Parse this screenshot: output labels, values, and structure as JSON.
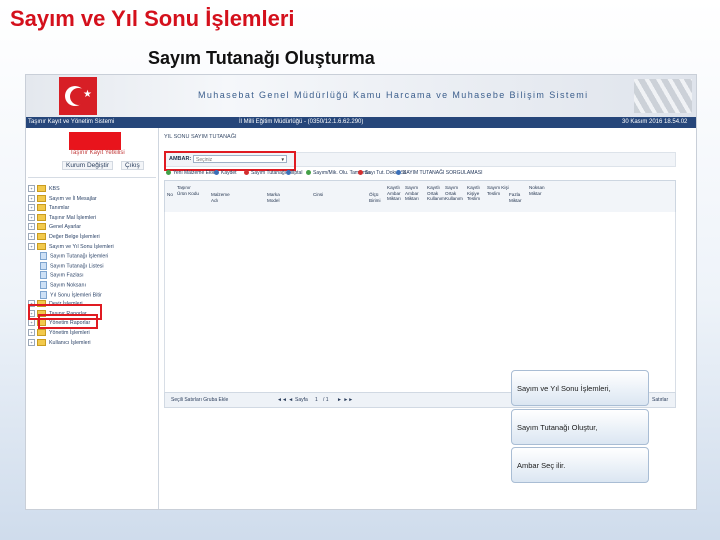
{
  "slide": {
    "title": "Sayım ve Yıl Sonu İşlemleri",
    "subtitle": "Sayım Tutanağı Oluşturma"
  },
  "app": {
    "banner_text": "Muhasebat Genel Müdürlüğü Kamu Harcama ve Muhasebe Bilişim Sistemi",
    "status_left": "Taşınır Kayıt ve Yönetim Sistemi",
    "status_center": "İl Milli Eğitim Müdürlüğü - (0350/12.1.6.62.290)",
    "status_right": "30 Kasım 2016 18.54.02"
  },
  "left_panel": {
    "link_text": "Taşınır Kayıt Yetkilisi",
    "buttons": [
      "Kurum Değiştir",
      "Çıkış"
    ],
    "tree": [
      {
        "label": "KBS",
        "kind": "folder",
        "level": 0
      },
      {
        "label": "Sayım ve İl Mesajlar",
        "kind": "folder",
        "level": 0
      },
      {
        "label": "Tanımlar",
        "kind": "folder",
        "level": 0
      },
      {
        "label": "Taşınır Mal İşlemleri",
        "kind": "folder",
        "level": 0
      },
      {
        "label": "Genel Ayarlar",
        "kind": "folder",
        "level": 0
      },
      {
        "label": "Değer Belge İşlemleri",
        "kind": "folder",
        "level": 0
      },
      {
        "label": "Sayım ve Yıl Sonu İşlemleri",
        "kind": "folder",
        "level": 0
      },
      {
        "label": "Sayım Tutanağı İşlemleri",
        "kind": "doc",
        "level": 1
      },
      {
        "label": "Sayım Tutanağı Listesi",
        "kind": "doc",
        "level": 1
      },
      {
        "label": "Sayım Fazlası",
        "kind": "doc",
        "level": 1
      },
      {
        "label": "Sayım Noksanı",
        "kind": "doc",
        "level": 1
      },
      {
        "label": "Yıl Sonu İşlemleri Bitir",
        "kind": "doc",
        "level": 1
      },
      {
        "label": "Devir İşlemleri",
        "kind": "folder",
        "level": 0
      },
      {
        "label": "Taşınır Raporlar",
        "kind": "folder",
        "level": 0
      },
      {
        "label": "Yönetim Raporlar",
        "kind": "folder",
        "level": 0
      },
      {
        "label": "Yönetim İşlemleri",
        "kind": "folder",
        "level": 0
      },
      {
        "label": "Kullanıcı İşlemleri",
        "kind": "folder",
        "level": 0
      }
    ]
  },
  "main": {
    "title": "YIL SONU SAYIM TUTANAĞI",
    "depot_label": "AMBAR:",
    "depot_value": "Seçiniz",
    "toolbar": [
      {
        "label": "Yeni Malzeme Ekle",
        "color": "green"
      },
      {
        "label": "Kaydet",
        "color": "blue"
      },
      {
        "label": "Sayım Tutanağı Sil",
        "color": "red"
      },
      {
        "label": "İptal",
        "color": "blue"
      },
      {
        "label": "Sayım/Mik. Olu. Tamamla",
        "color": "green"
      },
      {
        "label": "Sayı Tut. Dokur Sil",
        "color": "red"
      },
      {
        "label": "SAYIM TUTANAĞI SORGULAMASI",
        "color": "blue"
      }
    ],
    "columns": [
      "No",
      "Taşınır Ürün Kodu",
      "Malzeme Adı",
      "Marka Model",
      "Cinsi",
      "Ölçü Birimi",
      "Kayıtlı Ambar Miktarı",
      "Sayım Ambar Miktarı",
      "Kayıtlı Ortak Kullanım",
      "Sayım Ortak Kullanım",
      "Kayıtlı Kişiye Teslim",
      "Sayım Kişi Teslim",
      "Fazla Miktar",
      "Noksan Miktar"
    ],
    "pager": {
      "add_text": "Seçili Satırları Gruba Ekle",
      "page_label": "Sayfa",
      "page": "1",
      "of": "/ 1",
      "right_text": "Satırlar"
    }
  },
  "callouts": [
    "Sayım ve Yıl Sonu İşlemleri,",
    "Sayım Tutanağı Oluştur,",
    "Ambar Seç ilir."
  ]
}
